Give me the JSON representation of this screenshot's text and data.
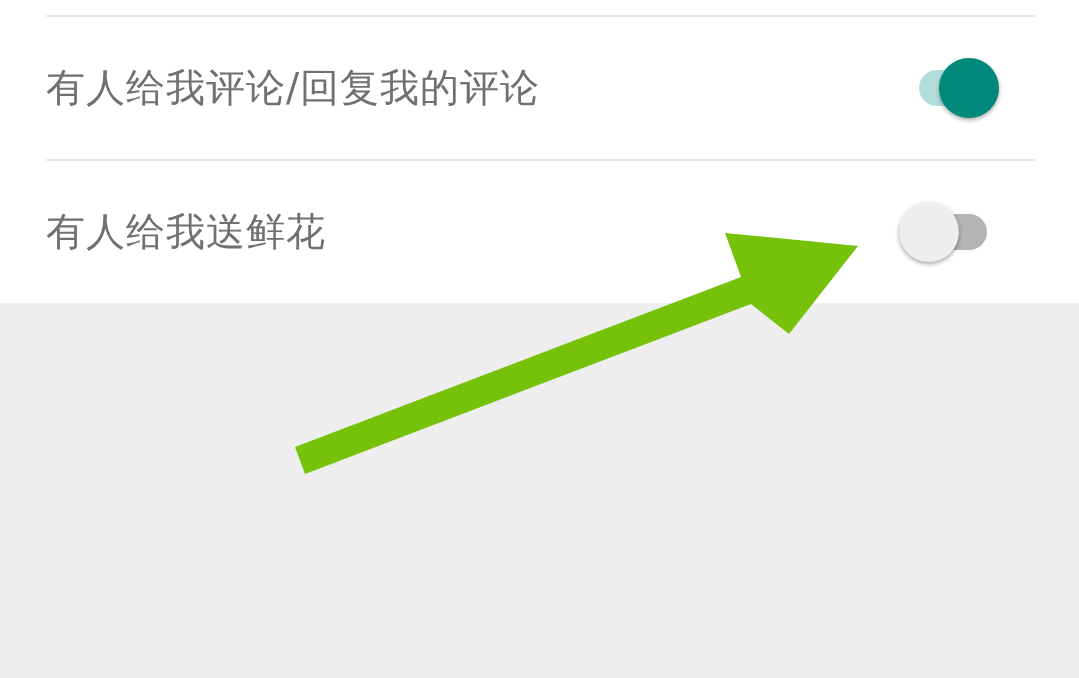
{
  "rows": [
    {
      "label": "有人给我评论/回复我的评论",
      "on": true
    },
    {
      "label": "有人给我送鲜花",
      "on": false
    }
  ]
}
